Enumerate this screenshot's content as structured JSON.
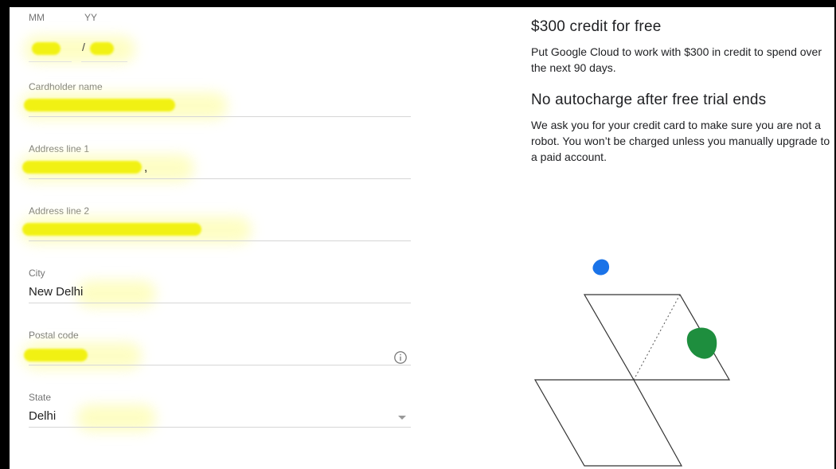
{
  "card_expiry": {
    "month_label": "MM",
    "year_label": "YY",
    "separator": "/"
  },
  "form": {
    "cardholder_name": {
      "label": "Cardholder name"
    },
    "address_line_1": {
      "label": "Address line 1",
      "visible_suffix": ","
    },
    "address_line_2": {
      "label": "Address line 2"
    },
    "city": {
      "label": "City",
      "value": "New Delhi"
    },
    "postal_code": {
      "label": "Postal code",
      "icon": "info-icon"
    },
    "state": {
      "label": "State",
      "value": "Delhi",
      "icon": "dropdown-arrow-icon"
    }
  },
  "promo": {
    "heading_1": "$300 credit for free",
    "text_1": "Put Google Cloud to work with $300 in credit to spend over the next 90 days.",
    "heading_2": "No autocharge after free trial ends",
    "text_2": "We ask you for your credit card to make sure you are not a robot. You won’t be charged unless you manually upgrade to a paid account."
  },
  "colors": {
    "redaction": "#f1f10a",
    "accent_blue": "#1a73e8",
    "accent_green": "#1e8e3e"
  }
}
